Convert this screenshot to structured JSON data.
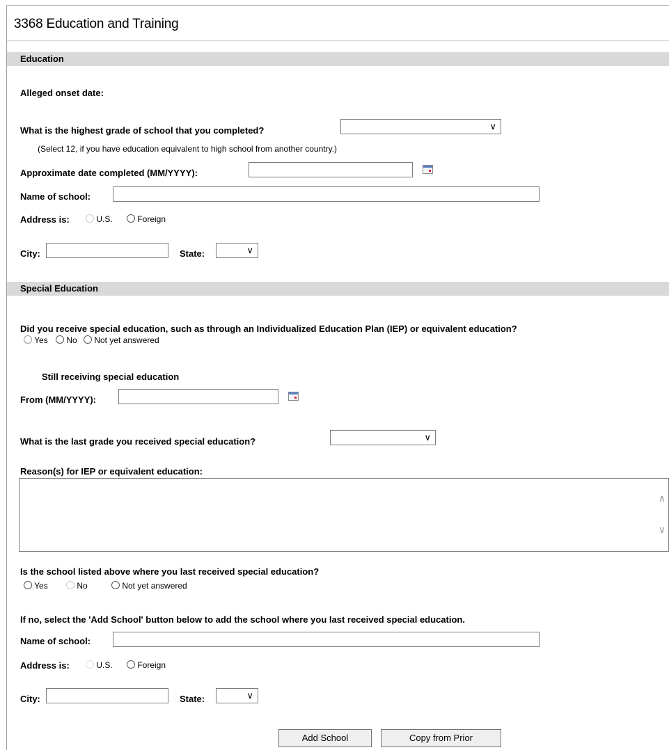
{
  "page": {
    "title": "3368 Education and Training"
  },
  "education": {
    "section_label": "Education",
    "onset_label": "Alleged onset date:",
    "grade_question": "What is the highest grade of school that you completed?",
    "grade_value": "",
    "grade_note": "(Select 12, if you have education equivalent to high school from another country.)",
    "date_completed_label": "Approximate date completed (MM/YYYY):",
    "date_completed_value": "",
    "school_name_label": "Name of school:",
    "school_name_value": "",
    "address_label": "Address is:",
    "address_options": [
      "U.S.",
      "Foreign"
    ],
    "city_label": "City:",
    "city_value": "",
    "state_label": "State:",
    "state_value": ""
  },
  "special": {
    "section_label": "Special Education",
    "question": "Did you receive special education, such as through an Individualized Education Plan (IEP) or equivalent education?",
    "options": [
      "Yes",
      "No",
      "Not yet answered"
    ],
    "still_receiving_label": "Still receiving special education",
    "from_label": "From (MM/YYYY):",
    "from_value": "",
    "last_grade_question": "What is the last grade you received special education?",
    "last_grade_value": "",
    "reasons_label": "Reason(s) for IEP or equivalent education:",
    "reasons_value": "",
    "school_listed_question": "Is the school listed above where you last received special education?",
    "school_listed_options": [
      "Yes",
      "No",
      "Not yet answered"
    ],
    "add_school_instruction": "If no, select the 'Add School' button below to add the school where you last received special education.",
    "school_name_label": "Name of school:",
    "school_name_value": "",
    "address_label": "Address is:",
    "address_options": [
      "U.S.",
      "Foreign"
    ],
    "city_label": "City:",
    "city_value": "",
    "state_label": "State:",
    "state_value": ""
  },
  "buttons": {
    "add_school": "Add School",
    "copy_from_prior": "Copy from Prior"
  },
  "icons": {
    "calendar": "calendar-icon",
    "dropdown": "chevron-down-icon",
    "scroll_up": "chevron-up-icon",
    "scroll_down": "chevron-down-icon"
  }
}
